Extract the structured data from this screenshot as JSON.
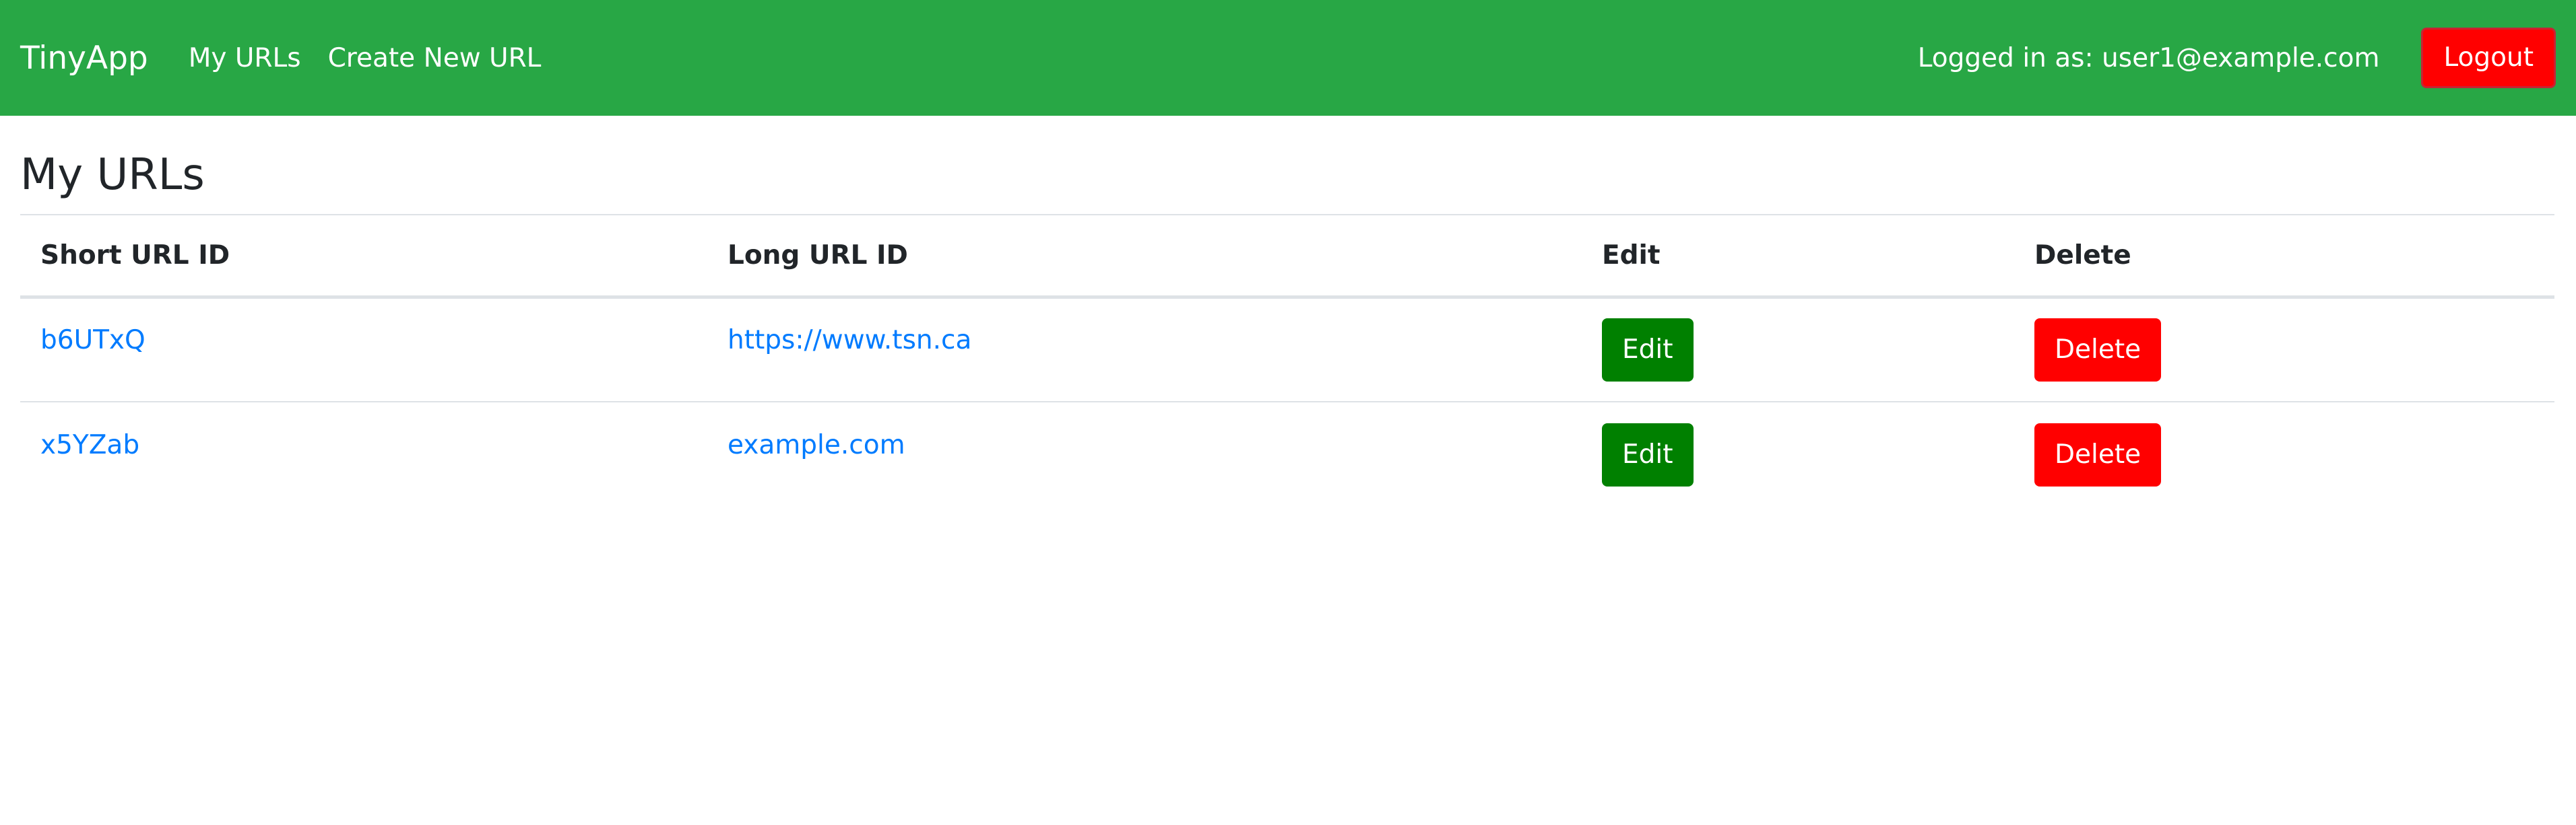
{
  "navbar": {
    "brand": "TinyApp",
    "links": [
      {
        "label": "My URLs"
      },
      {
        "label": "Create New URL"
      }
    ],
    "logged_in_text": "Logged in as: user1@example.com",
    "logout_label": "Logout"
  },
  "main": {
    "title": "My URLs",
    "table": {
      "headers": [
        "Short URL ID",
        "Long URL ID",
        "Edit",
        "Delete"
      ],
      "rows": [
        {
          "short_id": "b6UTxQ",
          "long_url": "https://www.tsn.ca",
          "edit_label": "Edit",
          "delete_label": "Delete"
        },
        {
          "short_id": "x5YZab",
          "long_url": "example.com",
          "edit_label": "Edit",
          "delete_label": "Delete"
        }
      ]
    }
  },
  "colors": {
    "navbar_bg": "#28a745",
    "link": "#007bff",
    "edit_button": "#008000",
    "delete_button": "#ff0000",
    "logout_button": "#ff0000"
  }
}
